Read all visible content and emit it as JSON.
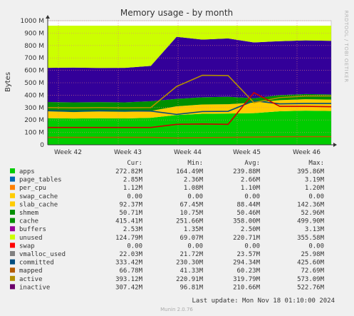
{
  "chart_data": {
    "type": "area",
    "title": "Memory usage - by month",
    "ylabel": "Bytes",
    "side_label": "RRDTOOL / TOBI OETIKER",
    "ylim": [
      0,
      1000
    ],
    "y_unit": "M",
    "y_ticks": [
      "0",
      "100 M",
      "200 M",
      "300 M",
      "400 M",
      "500 M",
      "600 M",
      "700 M",
      "800 M",
      "900 M",
      "1000 M"
    ],
    "x_ticks": [
      "Week 42",
      "Week 43",
      "Week 44",
      "Week 45",
      "Week 46"
    ],
    "columns": [
      "Cur:",
      "Min:",
      "Avg:",
      "Max:"
    ],
    "series": [
      {
        "name": "apps",
        "color": "#00cc00",
        "cur": "272.82M",
        "min": "164.49M",
        "avg": "239.88M",
        "max": "395.86M"
      },
      {
        "name": "page_tables",
        "color": "#0066b3",
        "cur": "2.85M",
        "min": "2.36M",
        "avg": "2.66M",
        "max": "3.19M"
      },
      {
        "name": "per_cpu",
        "color": "#ff8000",
        "cur": "1.12M",
        "min": "1.08M",
        "avg": "1.10M",
        "max": "1.20M"
      },
      {
        "name": "swap_cache",
        "color": "#ffcc00",
        "cur": "0.00",
        "min": "0.00",
        "avg": "0.00",
        "max": "0.00"
      },
      {
        "name": "slab_cache",
        "color": "#ffcc00",
        "cur": "92.37M",
        "min": "67.45M",
        "avg": "88.44M",
        "max": "142.36M"
      },
      {
        "name": "shmem",
        "color": "#008f00",
        "cur": "50.71M",
        "min": "10.75M",
        "avg": "50.46M",
        "max": "52.96M"
      },
      {
        "name": "cache",
        "color": "#008f00",
        "cur": "415.41M",
        "min": "251.66M",
        "avg": "358.00M",
        "max": "499.90M"
      },
      {
        "name": "buffers",
        "color": "#990099",
        "cur": "2.53M",
        "min": "1.35M",
        "avg": "2.50M",
        "max": "3.13M"
      },
      {
        "name": "unused",
        "color": "#ccff00",
        "cur": "124.79M",
        "min": "69.07M",
        "avg": "220.71M",
        "max": "355.58M"
      },
      {
        "name": "swap",
        "color": "#ff0000",
        "cur": "0.00",
        "min": "0.00",
        "avg": "0.00",
        "max": "0.00"
      },
      {
        "name": "vmalloc_used",
        "color": "#808080",
        "cur": "22.03M",
        "min": "21.72M",
        "avg": "23.57M",
        "max": "25.98M"
      },
      {
        "name": "committed",
        "color": "#004d7f",
        "cur": "333.42M",
        "min": "230.30M",
        "avg": "294.34M",
        "max": "425.60M"
      },
      {
        "name": "mapped",
        "color": "#b35a00",
        "cur": "66.78M",
        "min": "41.33M",
        "avg": "60.23M",
        "max": "72.69M"
      },
      {
        "name": "active",
        "color": "#b38f00",
        "cur": "393.12M",
        "min": "220.91M",
        "avg": "319.79M",
        "max": "573.09M"
      },
      {
        "name": "inactive",
        "color": "#6b006b",
        "cur": "307.42M",
        "min": "96.81M",
        "avg": "210.66M",
        "max": "522.76M"
      }
    ],
    "stack_layers": [
      {
        "name": "apps",
        "color": "#00cc00",
        "values": [
          215,
          212,
          214,
          213,
          218,
          240,
          250,
          252,
          255,
          270,
          275,
          272
        ]
      },
      {
        "name": "slab_cache",
        "color": "#ffcc00",
        "values": [
          55,
          52,
          55,
          53,
          55,
          70,
          75,
          75,
          85,
          90,
          92,
          92
        ]
      },
      {
        "name": "cache",
        "color": "#008f00",
        "values": [
          75,
          78,
          75,
          76,
          78,
          60,
          58,
          60,
          35,
          40,
          42,
          42
        ]
      },
      {
        "name": "buffers",
        "color": "#330099",
        "values": [
          275,
          280,
          275,
          278,
          285,
          500,
          465,
          470,
          450,
          435,
          432,
          432
        ]
      },
      {
        "name": "unused",
        "color": "#ccff00",
        "values": [
          340,
          338,
          341,
          340,
          324,
          90,
          112,
          103,
          135,
          125,
          119,
          122
        ]
      }
    ],
    "line_series": [
      {
        "name": "committed",
        "color": "#004d7f",
        "values": [
          275,
          272,
          275,
          273,
          272,
          245,
          268,
          270,
          355,
          330,
          333,
          333
        ]
      },
      {
        "name": "active",
        "color": "#b38f00",
        "values": [
          300,
          298,
          300,
          298,
          300,
          470,
          560,
          558,
          340,
          380,
          393,
          393
        ]
      },
      {
        "name": "swap",
        "color": "#cc0000",
        "values": [
          140,
          140,
          140,
          140,
          140,
          165,
          168,
          165,
          420,
          310,
          310,
          307
        ]
      },
      {
        "name": "mapped",
        "color": "#b35a00",
        "values": [
          60,
          60,
          60,
          60,
          60,
          55,
          58,
          60,
          62,
          65,
          66,
          66
        ]
      }
    ],
    "footer": "Last update: Mon Nov 18 01:10:00 2024",
    "munin_version": "Munin 2.0.76"
  }
}
